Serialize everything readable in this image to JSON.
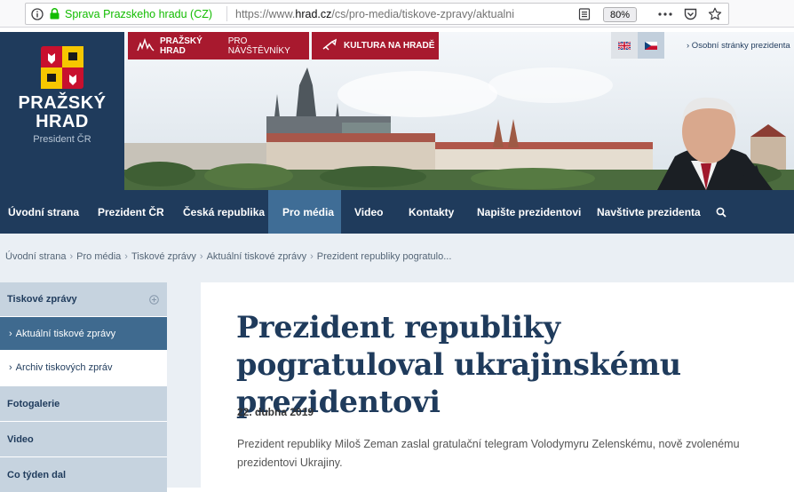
{
  "browser": {
    "site_identity": "Sprava Prazskeho hradu (CZ)",
    "url_prefix": "https://www.",
    "url_domain": "hrad.cz",
    "url_path": "/cs/pro-media/tiskove-zpravy/aktualni",
    "zoom": "80%"
  },
  "header": {
    "logo_line1": "PRAŽSKÝ",
    "logo_line2": "HRAD",
    "logo_sub": "President ČR",
    "tab_visitors_bold": "PRAŽSKÝ HRAD",
    "tab_visitors_rest": " PRO NÁVŠTĚVNÍKY",
    "tab_culture": "KULTURA NA HRADĚ",
    "personal_link": "› Osobní stránky prezidenta"
  },
  "nav": {
    "items": [
      "Úvodní strana",
      "Prezident ČR",
      "Česká republika",
      "Pro média",
      "Video",
      "Kontakty",
      "Napište prezidentovi",
      "Navštivte prezidenta"
    ]
  },
  "breadcrumb": [
    "Úvodní strana",
    "Pro média",
    "Tiskové zprávy",
    "Aktuální tiskové zprávy",
    "Prezident republiky pogratulo..."
  ],
  "sidebar": {
    "section": "Tiskové zprávy",
    "sub_active": "Aktuální tiskové zprávy",
    "sub_archive": "Archiv tiskových zpráv",
    "items": [
      "Fotogalerie",
      "Video",
      "Co týden dal"
    ]
  },
  "article": {
    "title": "Prezident republiky pogratuloval ukrajinskému prezidentovi",
    "date": "22. dubna 2019",
    "lead": "Prezident republiky Miloš Zeman zaslal gratulační telegram Volodymyru Zelenskému, nově zvolenému prezidentovi Ukrajiny."
  },
  "colors": {
    "navy": "#1f3b5c",
    "nav_active": "#3f6d96",
    "red": "#a8192e",
    "sidebar_active": "#3f6a8f",
    "secure_green": "#12bc00"
  },
  "icons": [
    "info-icon",
    "lock-icon",
    "reader-view-icon",
    "more-icon",
    "pocket-icon",
    "bookmark-star-icon",
    "search-icon",
    "expand-icon",
    "uk-flag-icon",
    "cz-flag-icon"
  ]
}
